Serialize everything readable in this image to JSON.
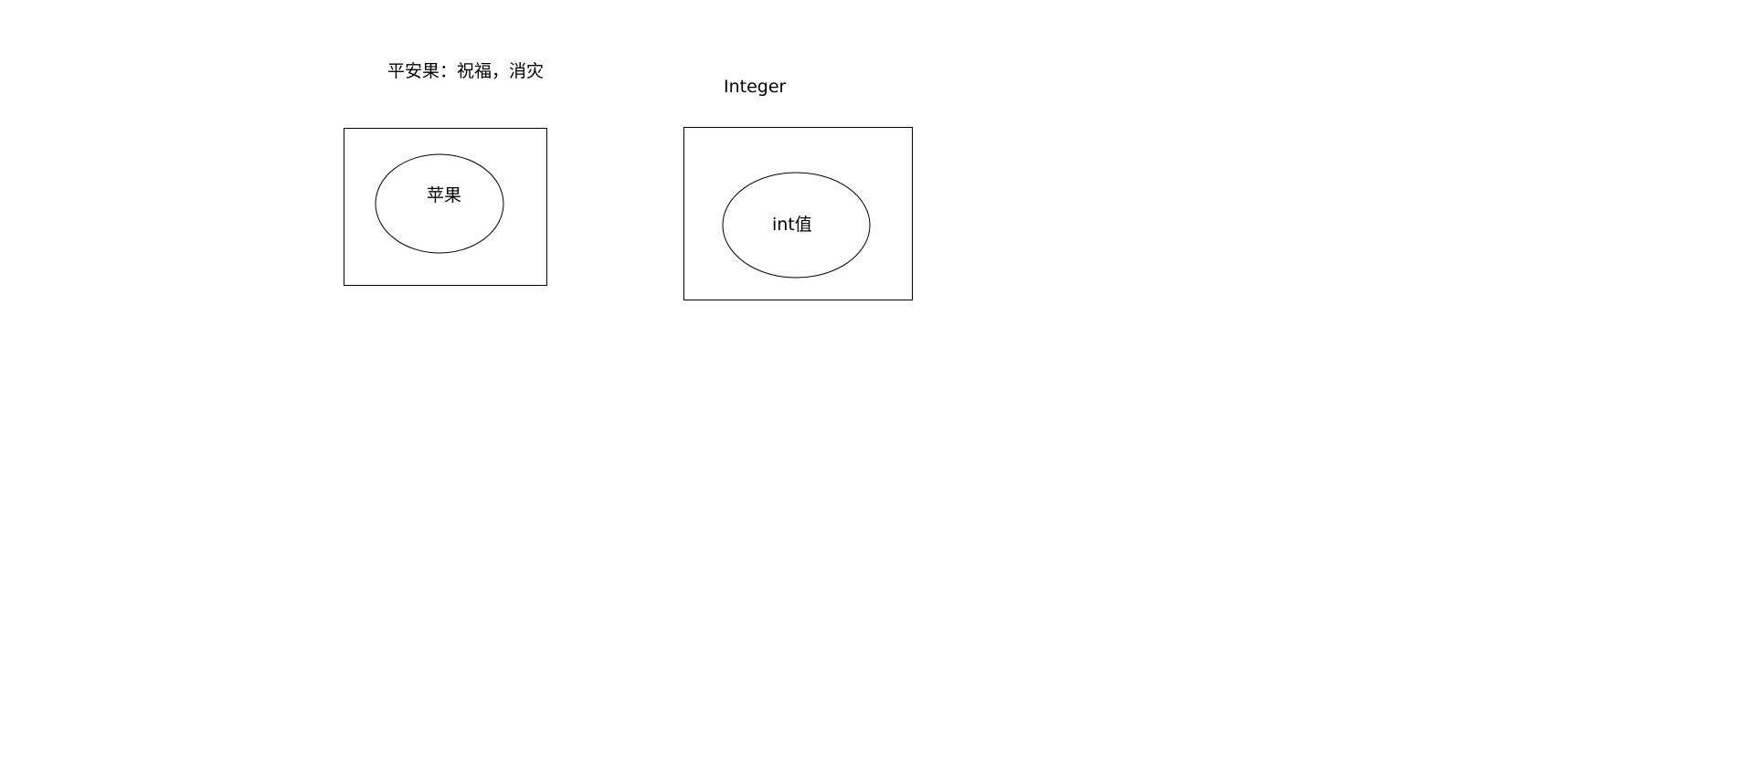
{
  "diagram": {
    "left_caption": "平安果：祝福，消灾",
    "right_caption": "Integer",
    "left_inner": "苹果",
    "right_inner": "int值"
  },
  "colors": {
    "stroke": "#000000",
    "background": "#ffffff"
  }
}
